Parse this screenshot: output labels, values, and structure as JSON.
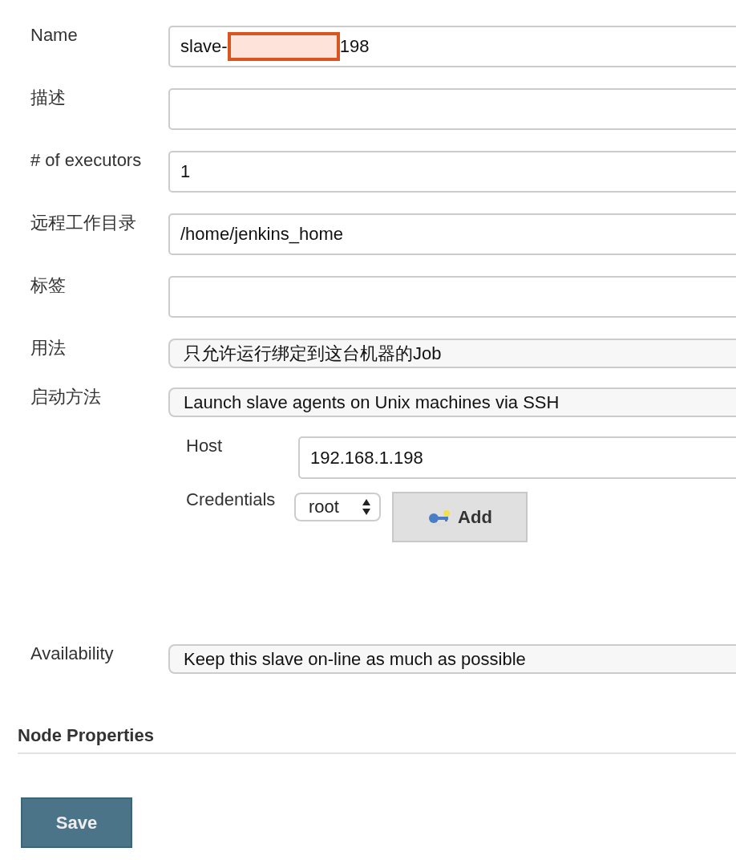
{
  "fields": [
    {
      "kind": "text",
      "label": "Name",
      "parts": [
        {
          "kind": "text",
          "text": "slave-"
        },
        {
          "kind": "redaction"
        },
        {
          "kind": "text",
          "text": "198"
        }
      ]
    },
    {
      "kind": "text",
      "label": "描述"
    },
    {
      "kind": "text",
      "label": "# of executors",
      "parts": [
        {
          "kind": "text",
          "text": "1"
        }
      ]
    },
    {
      "kind": "text",
      "label": "远程工作目录",
      "parts": [
        {
          "kind": "text",
          "text": "/home/jenkins_home"
        }
      ]
    },
    {
      "kind": "text",
      "label": "标签"
    },
    {
      "kind": "select",
      "label": "用法",
      "value": "只允许运行绑定到这台机器的Job"
    },
    {
      "kind": "select",
      "label": "启动方法",
      "value": "Launch slave agents on Unix machines via SSH"
    }
  ],
  "launch": {
    "host_label": "Host",
    "host": "192.168.1.198",
    "credentials_label": "Credentials",
    "credentials": "root",
    "add_button": "Add"
  },
  "availability": {
    "label": "Availability",
    "value": "Keep this slave on-line as much as possible"
  },
  "section_title": "Node Properties",
  "save_button": "Save"
}
